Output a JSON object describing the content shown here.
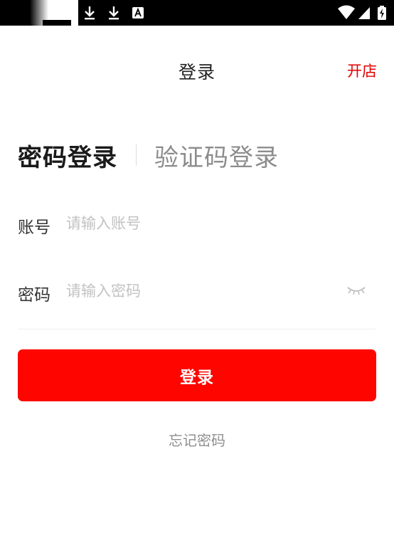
{
  "status_bar": {
    "icons_left": [
      "notification-box-icon",
      "download-icon",
      "download-icon",
      "app-a-icon"
    ],
    "icons_right": [
      "wifi-icon",
      "cellular-signal-icon",
      "battery-charging-icon"
    ],
    "background": "#000000"
  },
  "header": {
    "title": "登录",
    "open_store_label": "开店",
    "accent_color": "#e10000"
  },
  "tabs": {
    "password_login": "密码登录",
    "code_login": "验证码登录",
    "active": "password_login"
  },
  "form": {
    "account": {
      "label": "账号",
      "value": "",
      "placeholder": "请输入账号"
    },
    "password": {
      "label": "密码",
      "value": "",
      "placeholder": "请输入密码",
      "visibility_icon": "eye-closed-icon"
    }
  },
  "actions": {
    "login_label": "登录",
    "login_color": "#ff0500",
    "forgot_password_label": "忘记密码"
  }
}
